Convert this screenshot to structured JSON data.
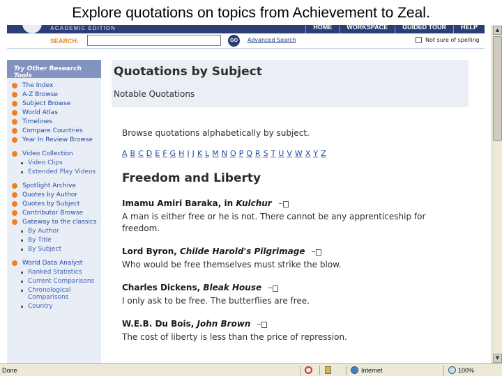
{
  "caption": "Explore quotations on topics from Achievement to Zeal.",
  "banner": {
    "edition": "ACADEMIC EDITION",
    "nav": [
      "HOME",
      "WORKSPACE",
      "GUIDED TOUR",
      "HELP"
    ]
  },
  "search": {
    "label": "SEARCH:",
    "value": "",
    "go": "GO",
    "advanced": "Advanced Search",
    "spelling": "Not sure of spelling"
  },
  "sidebar": {
    "heading": "Try Other Research Tools",
    "items": [
      {
        "label": "The Index",
        "type": "main"
      },
      {
        "label": "A-Z Browse",
        "type": "main"
      },
      {
        "label": "Subject Browse",
        "type": "main"
      },
      {
        "label": "World Atlas",
        "type": "main"
      },
      {
        "label": "Timelines",
        "type": "main"
      },
      {
        "label": "Compare Countries",
        "type": "main"
      },
      {
        "label": "Year In Review Browse",
        "type": "main"
      },
      {
        "label": "Video Collection",
        "type": "main-gap"
      },
      {
        "label": "Video Clips",
        "type": "sub"
      },
      {
        "label": "Extended Play Videos",
        "type": "sub"
      },
      {
        "label": "Spotlight Archive",
        "type": "main-gap"
      },
      {
        "label": "Quotes by Author",
        "type": "main"
      },
      {
        "label": "Quotes by Subject",
        "type": "main"
      },
      {
        "label": "Contributor Browse",
        "type": "main"
      },
      {
        "label": "Gateway to the classics",
        "type": "main"
      },
      {
        "label": "By Author",
        "type": "sub"
      },
      {
        "label": "By Title",
        "type": "sub"
      },
      {
        "label": "By Subject",
        "type": "sub"
      },
      {
        "label": "World Data Analyst",
        "type": "main-gap"
      },
      {
        "label": "Ranked Statistics",
        "type": "sub"
      },
      {
        "label": "Current Comparisons",
        "type": "sub"
      },
      {
        "label": "Chronological Comparisons",
        "type": "sub"
      },
      {
        "label": "Country",
        "type": "sub"
      }
    ]
  },
  "main": {
    "title": "Quotations by Subject",
    "subtitle": "Notable Quotations",
    "browse_text": "Browse quotations alphabetically by subject.",
    "letters": [
      "A",
      "B",
      "C",
      "D",
      "E",
      "F",
      "G",
      "H",
      "I",
      "J",
      "K",
      "L",
      "M",
      "N",
      "O",
      "P",
      "Q",
      "R",
      "S",
      "T",
      "U",
      "V",
      "W",
      "X",
      "Y",
      "Z"
    ],
    "topic": "Freedom and Liberty",
    "quotes": [
      {
        "author": "Imamu Amiri Baraka, in ",
        "work": "Kulchur",
        "text": "A man is either free or he is not. There cannot be any apprenticeship for freedom."
      },
      {
        "author": "Lord Byron, ",
        "work": "Childe Harold's Pilgrimage",
        "text": "Who would be free themselves must strike the blow."
      },
      {
        "author": "Charles Dickens, ",
        "work": "Bleak House",
        "text": "I only ask to be free. The butterflies are free."
      },
      {
        "author": "W.E.B. Du Bois, ",
        "work": "John Brown",
        "text": "The cost of liberty is less than the price of repression."
      }
    ]
  },
  "status": {
    "left": "Done",
    "zone": "Internet",
    "zoom": "100%"
  }
}
